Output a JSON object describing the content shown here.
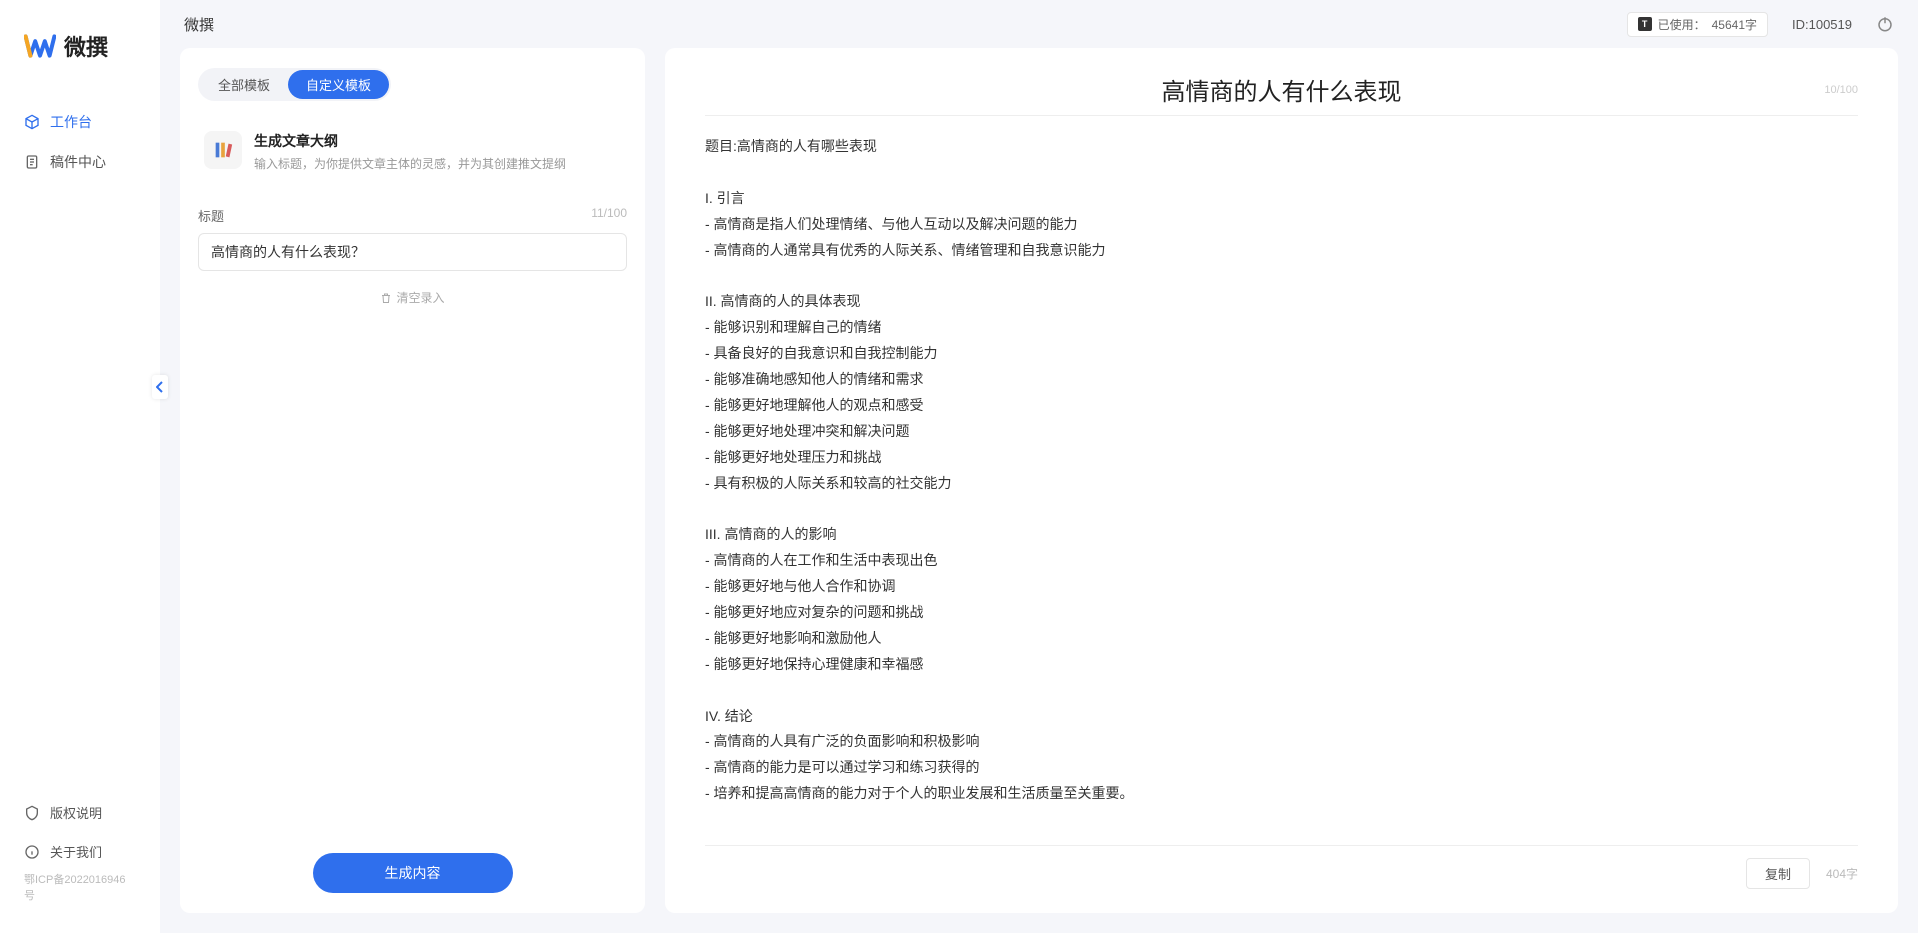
{
  "app": {
    "name": "微撰",
    "logo_text": "微撰"
  },
  "topbar": {
    "title": "微撰",
    "usage_label": "已使用：",
    "usage_value": "45641字",
    "id_label": "ID:100519"
  },
  "sidebar": {
    "items": [
      {
        "label": "工作台",
        "icon": "cube-icon",
        "active": true
      },
      {
        "label": "稿件中心",
        "icon": "document-icon",
        "active": false
      }
    ],
    "footer": [
      {
        "label": "版权说明",
        "icon": "shield-icon"
      },
      {
        "label": "关于我们",
        "icon": "info-icon"
      }
    ],
    "icp": "鄂ICP备2022016946号"
  },
  "left": {
    "tabs": [
      {
        "label": "全部模板",
        "active": false
      },
      {
        "label": "自定义模板",
        "active": true
      }
    ],
    "template": {
      "title": "生成文章大纲",
      "desc": "输入标题，为你提供文章主体的灵感，并为其创建推文提纲"
    },
    "title_field": {
      "label": "标题",
      "count": "11/100",
      "value": "高情商的人有什么表现？"
    },
    "clear_label": "清空录入",
    "generate_label": "生成内容"
  },
  "right": {
    "title": "高情商的人有什么表现",
    "title_count": "10/100",
    "body": "题目:高情商的人有哪些表现\n\nI. 引言\n- 高情商是指人们处理情绪、与他人互动以及解决问题的能力\n- 高情商的人通常具有优秀的人际关系、情绪管理和自我意识能力\n\nII. 高情商的人的具体表现\n- 能够识别和理解自己的情绪\n- 具备良好的自我意识和自我控制能力\n- 能够准确地感知他人的情绪和需求\n- 能够更好地理解他人的观点和感受\n- 能够更好地处理冲突和解决问题\n- 能够更好地处理压力和挑战\n- 具有积极的人际关系和较高的社交能力\n\nIII. 高情商的人的影响\n- 高情商的人在工作和生活中表现出色\n- 能够更好地与他人合作和协调\n- 能够更好地应对复杂的问题和挑战\n- 能够更好地影响和激励他人\n- 能够更好地保持心理健康和幸福感\n\nIV. 结论\n- 高情商的人具有广泛的负面影响和积极影响\n- 高情商的能力是可以通过学习和练习获得的\n- 培养和提高高情商的能力对于个人的职业发展和生活质量至关重要。",
    "copy_label": "复制",
    "char_count": "404字"
  }
}
